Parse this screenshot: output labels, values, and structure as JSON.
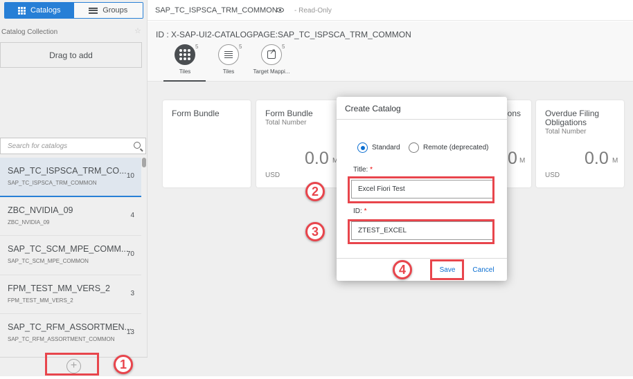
{
  "sidebar": {
    "tabs": [
      {
        "label": "Catalogs",
        "icon": "grid-icon",
        "active": true
      },
      {
        "label": "Groups",
        "icon": "menu-icon",
        "active": false
      }
    ],
    "collection_title": "Catalog Collection",
    "drag_label": "Drag to add",
    "search_placeholder": "Search for catalogs",
    "items": [
      {
        "title": "SAP_TC_ISPSCA_TRM_CO...",
        "subtitle": "SAP_TC_ISPSCA_TRM_COMMON",
        "count": "10",
        "selected": true
      },
      {
        "title": "ZBC_NVIDIA_09",
        "subtitle": "ZBC_NVIDIA_09",
        "count": "4"
      },
      {
        "title": "SAP_TC_SCM_MPE_COMM...",
        "subtitle": "SAP_TC_SCM_MPE_COMMON",
        "count": "70"
      },
      {
        "title": "FPM_TEST_MM_VERS_2",
        "subtitle": "FPM_TEST_MM_VERS_2",
        "count": "3"
      },
      {
        "title": "SAP_TC_RFM_ASSORTMEN...",
        "subtitle": "SAP_TC_RFM_ASSORTMENT_COMMON",
        "count": "13"
      }
    ],
    "add_icon": "plus-circle-icon"
  },
  "header": {
    "title": "SAP_TC_ISPSCA_TRM_COMMON",
    "status": "- Read-Only"
  },
  "main": {
    "id_title": "ID : X-SAP-UI2-CATALOGPAGE:SAP_TC_ISPSCA_TRM_COMMON",
    "tabs": [
      {
        "label": "Tiles",
        "count": "5",
        "icon": "grid-icon",
        "selected": true
      },
      {
        "label": "Tiles",
        "count": "5",
        "icon": "list-icon"
      },
      {
        "label": "Target Mappi...",
        "count": "5",
        "icon": "share-icon"
      }
    ],
    "tiles": [
      {
        "title": "Form Bundle",
        "subtitle": "",
        "value": "",
        "unit_m": "",
        "currency": ""
      },
      {
        "title": "Form Bundle",
        "subtitle": "Total Number",
        "value": "0.0",
        "unit_m": "M",
        "currency": "USD"
      },
      {
        "title": "ions",
        "subtitle": "",
        "value": "0",
        "unit_m": "M",
        "currency": ""
      },
      {
        "title": "Overdue Filing Obligations",
        "subtitle": "Total Number",
        "value": "0.0",
        "unit_m": "M",
        "currency": "USD"
      }
    ]
  },
  "dialog": {
    "title": "Create Catalog",
    "radio_standard": "Standard",
    "radio_remote": "Remote (deprecated)",
    "title_label": "Title:",
    "title_value": "Excel Fiori Test",
    "id_label": "ID:",
    "id_value": "ZTEST_EXCEL",
    "required_mark": "*",
    "save_label": "Save",
    "cancel_label": "Cancel"
  },
  "annotations": {
    "steps": [
      "1",
      "2",
      "3",
      "4"
    ],
    "highlight_color": "#e8454c"
  },
  "colors": {
    "accent": "#0a6ed1",
    "highlight": "#e8454c"
  }
}
